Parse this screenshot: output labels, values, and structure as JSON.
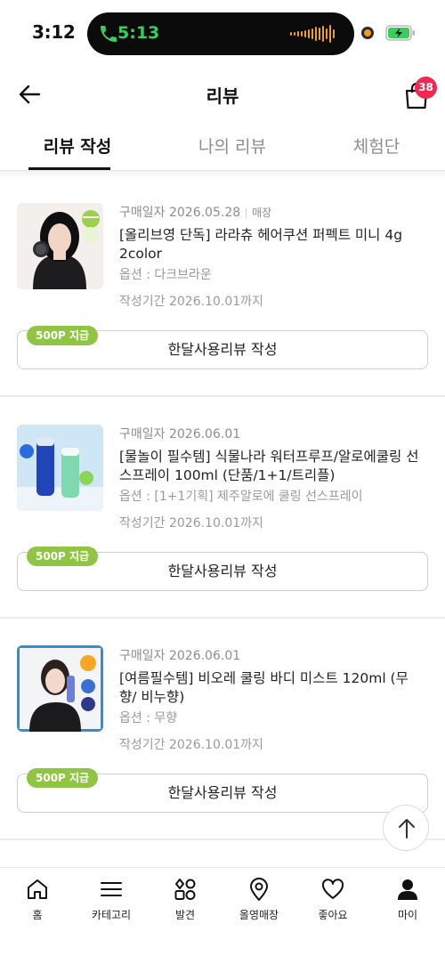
{
  "status_bar": {
    "time": "3:12",
    "call_time": "5:13",
    "call_color": "#35d05c",
    "recording_dot_color": "#f79a16",
    "battery_color": "#35d05c"
  },
  "header": {
    "title": "리뷰",
    "back_icon": "arrow-left-icon",
    "cart_icon": "shopping-bag-icon",
    "cart_count": "38"
  },
  "tabs": [
    {
      "label": "리뷰 작성",
      "active": true
    },
    {
      "label": "나의 리뷰",
      "active": false
    },
    {
      "label": "체험단",
      "active": false
    }
  ],
  "reviews": [
    {
      "purchase_date": "구매일자 2026.05.28",
      "channel": "매장",
      "product_name": "[올리브영 단독] 라라츄 헤어쿠션 퍼펙트 미니 4g 2color",
      "option": "옵션 : 다크브라운",
      "period": "작성기간 2026.10.01까지",
      "button_label": "한달사용리뷰 작성",
      "point_badge": "500P 지급"
    },
    {
      "purchase_date": "구매일자 2026.06.01",
      "channel": "",
      "product_name": "[물놀이 필수템] 식물나라 워터프루프/알로에쿨링 선 스프레이 100ml (단품/1+1/트리플)",
      "option": "옵션 : [1+1기획] 제주알로에 쿨링 선스프레이",
      "period": "작성기간 2026.10.01까지",
      "button_label": "한달사용리뷰 작성",
      "point_badge": "500P 지급"
    },
    {
      "purchase_date": "구매일자 2026.06.01",
      "channel": "",
      "product_name": "[여름필수템] 비오레 쿨링 바디 미스트 120ml (무향/ 비누향)",
      "option": "옵션 : 무향",
      "period": "작성기간 2026.10.01까지",
      "button_label": "한달사용리뷰 작성",
      "point_badge": "500P 지급"
    }
  ],
  "colors": {
    "point_badge": "#8fc543",
    "cart_badge": "#f02952",
    "muted_text": "#8d8d8d"
  },
  "scroll_top_icon": "arrow-up-icon",
  "bottom_nav": [
    {
      "label": "홈",
      "icon": "home-icon"
    },
    {
      "label": "카테고리",
      "icon": "menu-icon"
    },
    {
      "label": "발견",
      "icon": "discover-icon"
    },
    {
      "label": "올영매장",
      "icon": "map-pin-icon"
    },
    {
      "label": "좋아요",
      "icon": "heart-icon"
    },
    {
      "label": "마이",
      "icon": "user-icon"
    }
  ]
}
